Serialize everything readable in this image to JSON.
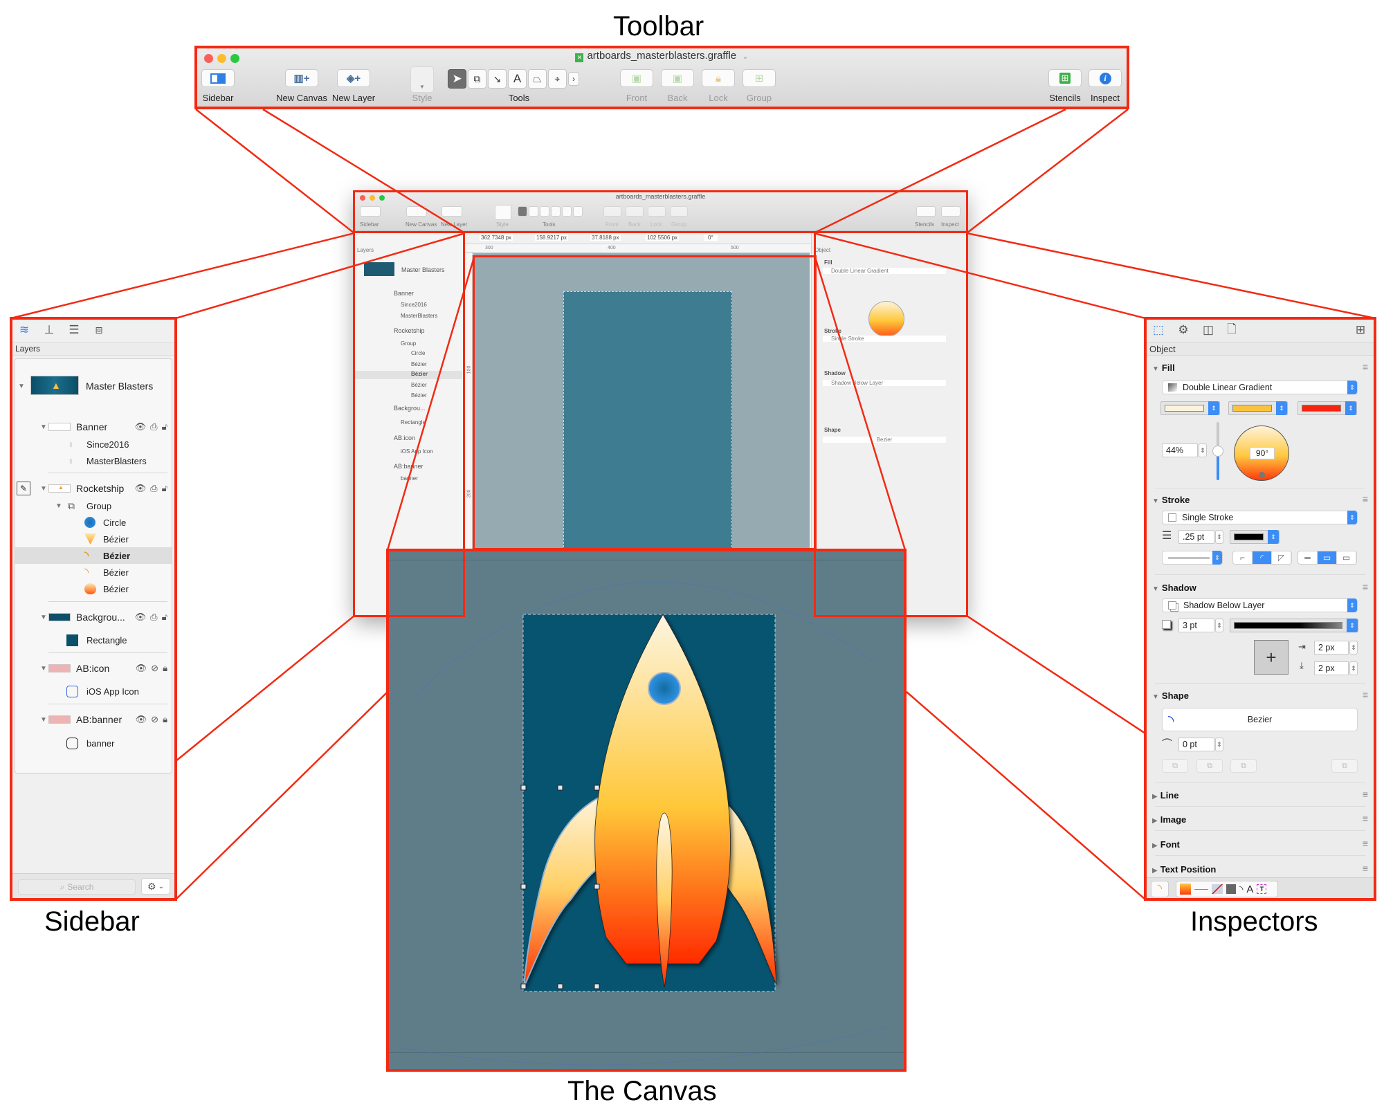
{
  "callouts": {
    "toolbar": "Toolbar",
    "sidebar": "Sidebar",
    "inspectors": "Inspectors",
    "canvas": "The Canvas"
  },
  "colors": {
    "callout_red": "#f22a13",
    "accent_blue": "#3d8df5",
    "canvas_bg": "#5f7d89",
    "artboard_bg": "#065470",
    "gradient_start": "#fdf3dc",
    "gradient_mid": "#ffc83a",
    "gradient_end": "#ff2a00"
  },
  "window": {
    "title": "artboards_masterblasters.graffle",
    "title_chevron": "chevron-down-icon"
  },
  "toolbar": {
    "sidebar": "Sidebar",
    "new_canvas": "New Canvas",
    "new_layer": "New Layer",
    "style": "Style",
    "tools": "Tools",
    "front": "Front",
    "back": "Back",
    "lock": "Lock",
    "group": "Group",
    "stencils": "Stencils",
    "inspect": "Inspect",
    "tool_list": [
      "selection-tool",
      "shape-tool",
      "line-tool",
      "text-tool",
      "pen-tool",
      "point-editor-tool",
      "more-tools"
    ],
    "text_tool_glyph": "A"
  },
  "geometry_bar": {
    "x": "362.7348 px",
    "y": "158.9217 px",
    "width": "37.8188 px",
    "height": "102.5506 px",
    "rotation": "0°"
  },
  "ruler": {
    "horizontal_ticks": [
      "300",
      "400",
      "500"
    ],
    "vertical_ticks": [
      "100",
      "200"
    ]
  },
  "sidebar": {
    "header": "Layers",
    "search_placeholder": "Search",
    "layers": [
      {
        "name": "Master Blasters",
        "type": "canvas"
      },
      {
        "name": "Banner",
        "type": "layer",
        "children": [
          "Since2016",
          "MasterBlasters"
        ]
      },
      {
        "name": "Rocketship",
        "type": "layer",
        "editing": true,
        "children": [
          {
            "name": "Group",
            "children": [
              "Circle",
              "Bézier",
              "Bézier",
              "Bézier",
              "Bézier"
            ]
          }
        ]
      },
      {
        "name": "Backgrou...",
        "type": "layer",
        "children": [
          "Rectangle"
        ]
      },
      {
        "name": "AB:icon",
        "type": "artboard-layer",
        "locked": true,
        "children": [
          "iOS App Icon"
        ]
      },
      {
        "name": "AB:banner",
        "type": "artboard-layer",
        "locked": true,
        "children": [
          "banner"
        ]
      }
    ],
    "items": {
      "master_blasters": "Master Blasters",
      "banner": "Banner",
      "since2016": "Since2016",
      "masterblasters": "MasterBlasters",
      "rocketship": "Rocketship",
      "group": "Group",
      "circle": "Circle",
      "bezier1": "Bézier",
      "bezier2": "Bézier",
      "bezier3": "Bézier",
      "bezier4": "Bézier",
      "background": "Backgrou...",
      "rectangle": "Rectangle",
      "ab_icon": "AB:icon",
      "ios_app_icon": "iOS App Icon",
      "ab_banner": "AB:banner",
      "banner_artboard": "banner"
    },
    "selected_item": "bezier2"
  },
  "inspector": {
    "header": "Object",
    "fill": {
      "title": "Fill",
      "type": "Double Linear Gradient",
      "color1": "#fdf3dc",
      "color2": "#fbc23f",
      "color3": "#f42410",
      "midpoint": "44%",
      "midpoint_value": 0.44,
      "angle": "90°"
    },
    "stroke": {
      "title": "Stroke",
      "type": "Single Stroke",
      "width": ".25 pt",
      "color": "#000000"
    },
    "shadow": {
      "title": "Shadow",
      "type": "Shadow Below Layer",
      "blur": "3 pt",
      "offset_x": "2 px",
      "offset_y": "2 px"
    },
    "shape": {
      "title": "Shape",
      "name": "Bezier",
      "corner_radius": "0 pt"
    },
    "collapsed_sections": [
      "Line",
      "Image",
      "Font",
      "Text Position"
    ],
    "bottom_text_glyph": "A"
  }
}
